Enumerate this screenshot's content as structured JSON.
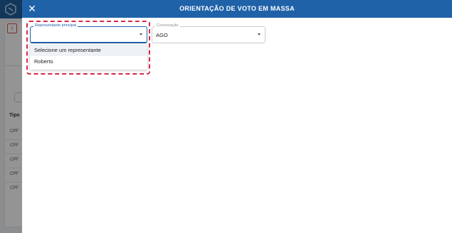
{
  "background": {
    "tipo_label": "Tipo",
    "rows": [
      "CPF",
      "CPF",
      "CPF",
      "CPF",
      "CPF"
    ]
  },
  "modal": {
    "title": "ORIENTAÇÃO DE VOTO EM MASSA",
    "close_icon": "close-icon"
  },
  "fields": {
    "representante": {
      "label": "Representante principal",
      "value": "",
      "options": [
        "Selecione um representante",
        "Roberto"
      ]
    },
    "convocacao": {
      "label": "Convocação",
      "value": "AGO"
    }
  },
  "colors": {
    "header": "#1f62a8",
    "highlight": "#d6294a"
  }
}
